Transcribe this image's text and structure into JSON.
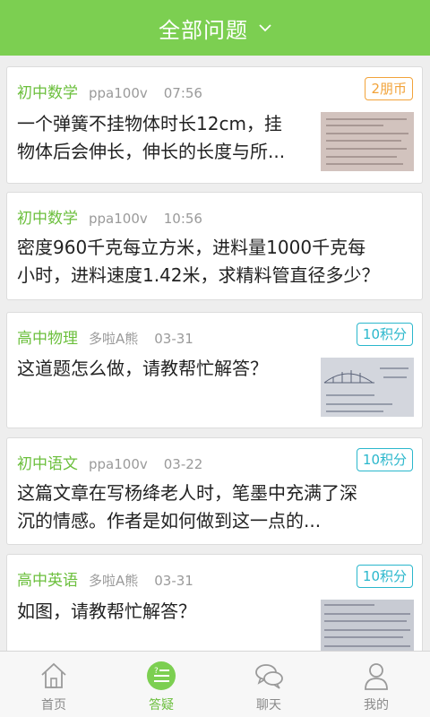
{
  "header": {
    "title": "全部问题"
  },
  "colors": {
    "accent": "#7ccf51",
    "subject": "#6bbf3c",
    "reward_orange": "#f2a33a",
    "reward_cyan": "#2ab7cc"
  },
  "questions": [
    {
      "subject": "初中数学",
      "user": "ppa100v",
      "time": "07:56",
      "reward": "2朋币",
      "line1": "一个弹簧不挂物体时长12cm，挂",
      "line2": "物体后会伸长，伸长的长度与所..."
    },
    {
      "subject": "初中数学",
      "user": "ppa100v",
      "time": "10:56",
      "line1": "密度960千克每立方米，进料量1000千克每",
      "line2": "小时，进料速度1.42米，求精料管直径多少？"
    },
    {
      "subject": "高中物理",
      "user": "多啦A熊",
      "time": "03-31",
      "reward": "10积分",
      "line1": "这道题怎么做，请教帮忙解答？"
    },
    {
      "subject": "初中语文",
      "user": "ppa100v",
      "time": "03-22",
      "reward": "10积分",
      "line1": "这篇文章在写杨绛老人时，笔墨中充满了深",
      "line2": "沉的情感。作者是如何做到这一点的..."
    },
    {
      "subject": "高中英语",
      "user": "多啦A熊",
      "time": "03-31",
      "reward": "10积分",
      "line1": "如图，请教帮忙解答？"
    }
  ],
  "tabs": [
    {
      "label": "首页",
      "icon": "home-icon"
    },
    {
      "label": "答疑",
      "icon": "qa-icon",
      "active": true
    },
    {
      "label": "聊天",
      "icon": "chat-icon"
    },
    {
      "label": "我的",
      "icon": "profile-icon"
    }
  ]
}
